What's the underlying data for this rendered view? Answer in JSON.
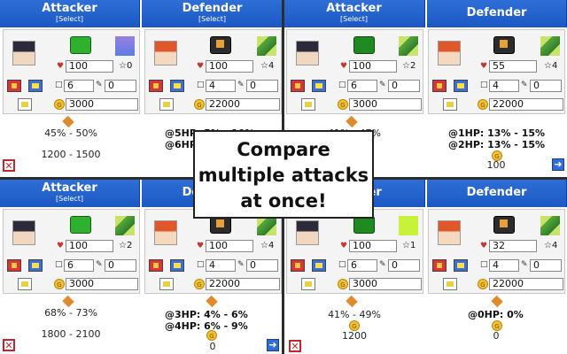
{
  "banner": {
    "text": "Compare multiple attacks at once!"
  },
  "labels": {
    "attacker": "Attacker",
    "defender": "Defender",
    "select": "[Select]"
  },
  "colors": {
    "header": "#1b58c4",
    "close": "#c0262e",
    "coin": "#f3c22e"
  },
  "icons": [
    "hp-heart-icon",
    "star-icon",
    "co-icon",
    "power-icon",
    "flag-icon",
    "coin-icon",
    "sword-icon",
    "close-icon",
    "next-arrow-icon"
  ],
  "calcs": [
    {
      "attacker": {
        "hp": "100",
        "stars": "0",
        "tower": "6",
        "tower2": "0",
        "funds": "3000"
      },
      "defender": {
        "hp": "100",
        "stars": "4",
        "tower": "4",
        "tower2": "0",
        "funds": "22000"
      },
      "damage": "45% - 50%",
      "lines": [
        "@5HP: 5% - 10%",
        "@6HP"
      ],
      "funds_damage": "1200 - 1500",
      "extra": ""
    },
    {
      "attacker": {
        "hp": "100",
        "stars": "2",
        "tower": "6",
        "tower2": "0",
        "funds": "3000"
      },
      "defender": {
        "hp": "55",
        "stars": "4",
        "tower": "4",
        "tower2": "0",
        "funds": "22000"
      },
      "damage": "41% - 47%",
      "lines": [
        "@1HP: 13% - 15%",
        "@2HP: 13% - 15%"
      ],
      "funds_damage": "100",
      "extra": ""
    },
    {
      "attacker": {
        "hp": "100",
        "stars": "2",
        "tower": "6",
        "tower2": "0",
        "funds": "3000"
      },
      "defender": {
        "hp": "100",
        "stars": "4",
        "tower": "4",
        "tower2": "0",
        "funds": "22000"
      },
      "damage": "68% - 73%",
      "lines": [
        "@3HP: 4% - 6%",
        "@4HP: 6% - 9%"
      ],
      "funds_damage": "1800 - 2100",
      "extra": "0"
    },
    {
      "attacker": {
        "hp": "100",
        "stars": "1",
        "tower": "6",
        "tower2": "0",
        "funds": "3000"
      },
      "defender": {
        "hp": "32",
        "stars": "4",
        "tower": "4",
        "tower2": "0",
        "funds": "22000"
      },
      "damage": "41% - 49%",
      "lines": [
        "@0HP: 0%"
      ],
      "funds_damage": "1200",
      "extra": "0"
    }
  ]
}
